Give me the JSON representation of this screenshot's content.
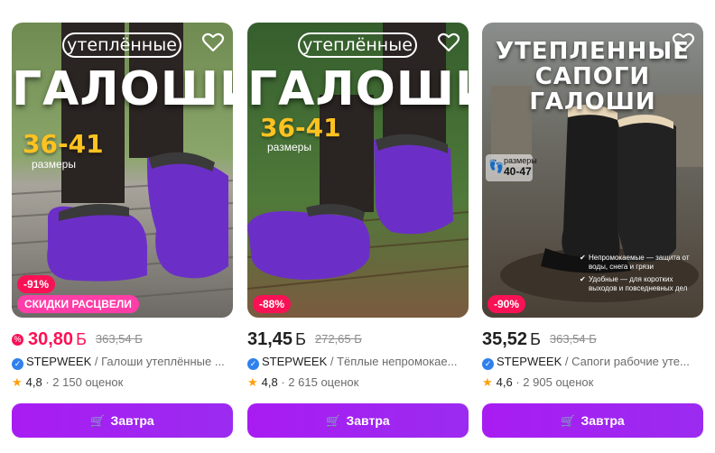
{
  "products": [
    {
      "image": {
        "pill": "утеплённые",
        "headline": "ГАЛОШИ",
        "sizes": "36-41",
        "sizes_sub": "размеры",
        "discount": "-91%",
        "promo": "СКИДКИ РАСЦВЕЛИ",
        "shoe_color": "#6b2fc7"
      },
      "price": "30,80",
      "currency": "Б",
      "old_price": "363,54 Б",
      "price_color": "#f91155",
      "brand": "STEPWEEK",
      "title": "/ Галоши утеплённые ...",
      "rating": "4,8",
      "reviews": "· 2 150 оценок",
      "button": "Завтра"
    },
    {
      "image": {
        "pill": "утеплённые",
        "headline": "ГАЛОШИ",
        "sizes": "36-41",
        "sizes_sub": "размеры",
        "discount": "-88%",
        "shoe_color": "#6b2fc7"
      },
      "price": "31,45",
      "currency": "Б",
      "old_price": "272,65 Б",
      "brand": "STEPWEEK",
      "title": "/ Тёплые непромокае...",
      "rating": "4,8",
      "reviews": "· 2 615 оценок",
      "button": "Завтра"
    },
    {
      "image": {
        "headline_line1": "УТЕПЛЕННЫЕ",
        "headline_line2": "САПОГИ ГАЛОШИ",
        "size_label": "размеры",
        "size_range": "40-47",
        "feature1": "Непромокаемые — защита от воды, снега и грязи",
        "feature2": "Удобные — для коротких выходов и повседневных дел",
        "discount": "-90%",
        "shoe_color": "#1c1c1c"
      },
      "price": "35,52",
      "currency": "Б",
      "old_price": "363,54 Б",
      "brand": "STEPWEEK",
      "title": "/ Сапоги рабочие уте...",
      "rating": "4,6",
      "reviews": "· 2 905 оценок",
      "button": "Завтра"
    }
  ],
  "icons": {
    "favorite": "heart-outline-icon",
    "cart": "cart-icon",
    "verified": "verified-check-icon",
    "star": "star-icon",
    "sale_badge": "percent-badge-icon"
  },
  "colors": {
    "accent": "#a020f0",
    "sale_red": "#f91155",
    "promo_pink": "#ff3da8",
    "star": "#ff9f0a",
    "verified": "#2f80ed"
  }
}
